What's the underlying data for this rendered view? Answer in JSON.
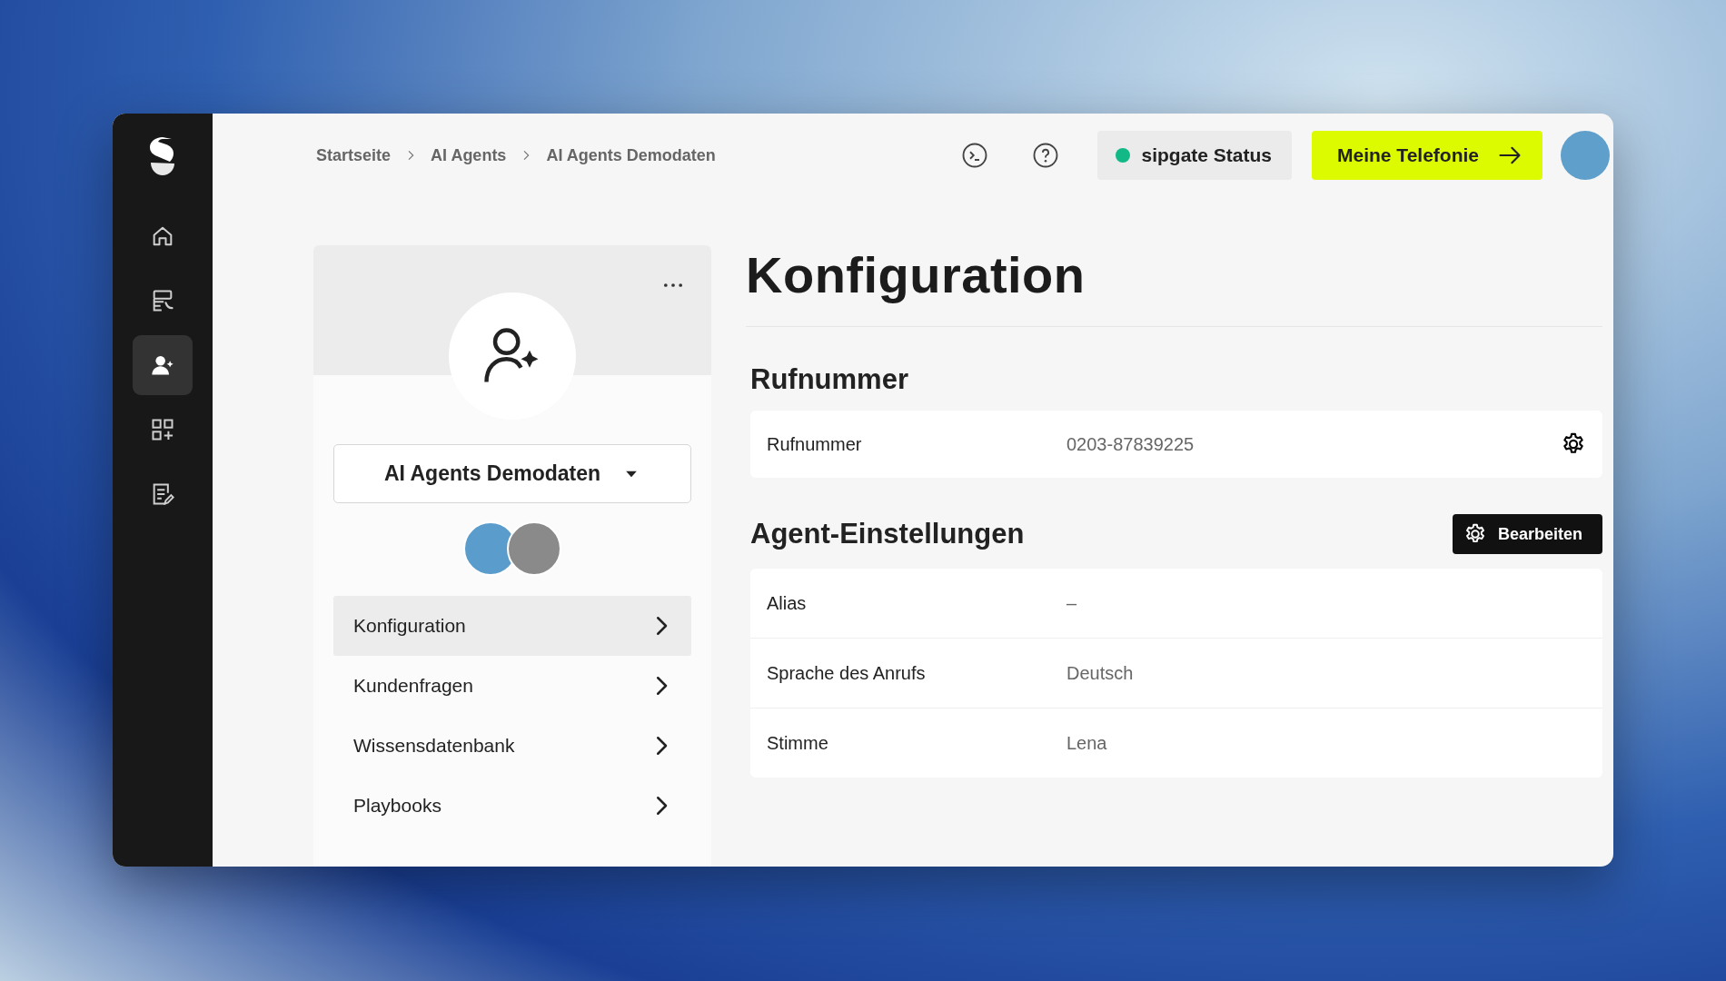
{
  "sidebar": {
    "items": [
      {
        "kind": "home",
        "selected": false
      },
      {
        "kind": "calls",
        "selected": false
      },
      {
        "kind": "agent",
        "selected": true
      },
      {
        "kind": "apps",
        "selected": false
      },
      {
        "kind": "notes",
        "selected": false
      }
    ]
  },
  "breadcrumbs": [
    "Startseite",
    "AI Agents",
    "AI Agents Demodaten"
  ],
  "status": {
    "label": "sipgate Status",
    "ok": true
  },
  "primary_button": "Meine Telefonie",
  "agent": {
    "name": "AI Agents Demodaten",
    "menu": [
      {
        "label": "Konfiguration",
        "selected": true
      },
      {
        "label": "Kundenfragen",
        "selected": false
      },
      {
        "label": "Wissensdatenbank",
        "selected": false
      },
      {
        "label": "Playbooks",
        "selected": false
      }
    ]
  },
  "page_title": "Konfiguration",
  "sections": [
    {
      "title": "Rufnummer",
      "rows": [
        {
          "kind": "setting",
          "label": "Rufnummer",
          "value": "0203-87839225"
        }
      ]
    },
    {
      "title": "Agent-Einstellungen",
      "button": "Bearbeiten",
      "rows": [
        {
          "kind": "plain",
          "label": "Alias",
          "value": "–"
        },
        {
          "kind": "plain",
          "label": "Sprache des Anrufs",
          "value": "Deutsch"
        },
        {
          "kind": "plain",
          "label": "Stimme",
          "value": "Lena"
        }
      ]
    }
  ]
}
